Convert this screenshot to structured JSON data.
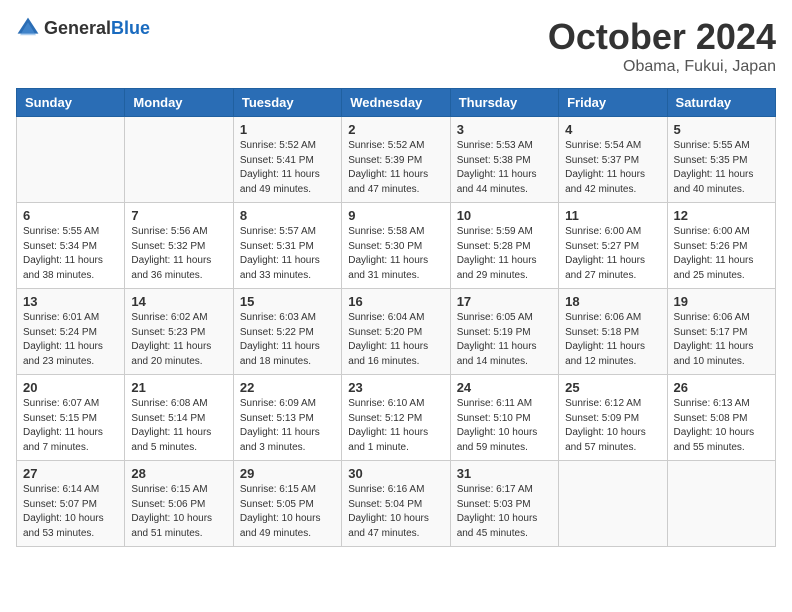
{
  "header": {
    "logo": {
      "general": "General",
      "blue": "Blue"
    },
    "title": "October 2024",
    "subtitle": "Obama, Fukui, Japan"
  },
  "weekdays": [
    "Sunday",
    "Monday",
    "Tuesday",
    "Wednesday",
    "Thursday",
    "Friday",
    "Saturday"
  ],
  "weeks": [
    [
      {
        "day": "",
        "content": ""
      },
      {
        "day": "",
        "content": ""
      },
      {
        "day": "1",
        "content": "Sunrise: 5:52 AM\nSunset: 5:41 PM\nDaylight: 11 hours and 49 minutes."
      },
      {
        "day": "2",
        "content": "Sunrise: 5:52 AM\nSunset: 5:39 PM\nDaylight: 11 hours and 47 minutes."
      },
      {
        "day": "3",
        "content": "Sunrise: 5:53 AM\nSunset: 5:38 PM\nDaylight: 11 hours and 44 minutes."
      },
      {
        "day": "4",
        "content": "Sunrise: 5:54 AM\nSunset: 5:37 PM\nDaylight: 11 hours and 42 minutes."
      },
      {
        "day": "5",
        "content": "Sunrise: 5:55 AM\nSunset: 5:35 PM\nDaylight: 11 hours and 40 minutes."
      }
    ],
    [
      {
        "day": "6",
        "content": "Sunrise: 5:55 AM\nSunset: 5:34 PM\nDaylight: 11 hours and 38 minutes."
      },
      {
        "day": "7",
        "content": "Sunrise: 5:56 AM\nSunset: 5:32 PM\nDaylight: 11 hours and 36 minutes."
      },
      {
        "day": "8",
        "content": "Sunrise: 5:57 AM\nSunset: 5:31 PM\nDaylight: 11 hours and 33 minutes."
      },
      {
        "day": "9",
        "content": "Sunrise: 5:58 AM\nSunset: 5:30 PM\nDaylight: 11 hours and 31 minutes."
      },
      {
        "day": "10",
        "content": "Sunrise: 5:59 AM\nSunset: 5:28 PM\nDaylight: 11 hours and 29 minutes."
      },
      {
        "day": "11",
        "content": "Sunrise: 6:00 AM\nSunset: 5:27 PM\nDaylight: 11 hours and 27 minutes."
      },
      {
        "day": "12",
        "content": "Sunrise: 6:00 AM\nSunset: 5:26 PM\nDaylight: 11 hours and 25 minutes."
      }
    ],
    [
      {
        "day": "13",
        "content": "Sunrise: 6:01 AM\nSunset: 5:24 PM\nDaylight: 11 hours and 23 minutes."
      },
      {
        "day": "14",
        "content": "Sunrise: 6:02 AM\nSunset: 5:23 PM\nDaylight: 11 hours and 20 minutes."
      },
      {
        "day": "15",
        "content": "Sunrise: 6:03 AM\nSunset: 5:22 PM\nDaylight: 11 hours and 18 minutes."
      },
      {
        "day": "16",
        "content": "Sunrise: 6:04 AM\nSunset: 5:20 PM\nDaylight: 11 hours and 16 minutes."
      },
      {
        "day": "17",
        "content": "Sunrise: 6:05 AM\nSunset: 5:19 PM\nDaylight: 11 hours and 14 minutes."
      },
      {
        "day": "18",
        "content": "Sunrise: 6:06 AM\nSunset: 5:18 PM\nDaylight: 11 hours and 12 minutes."
      },
      {
        "day": "19",
        "content": "Sunrise: 6:06 AM\nSunset: 5:17 PM\nDaylight: 11 hours and 10 minutes."
      }
    ],
    [
      {
        "day": "20",
        "content": "Sunrise: 6:07 AM\nSunset: 5:15 PM\nDaylight: 11 hours and 7 minutes."
      },
      {
        "day": "21",
        "content": "Sunrise: 6:08 AM\nSunset: 5:14 PM\nDaylight: 11 hours and 5 minutes."
      },
      {
        "day": "22",
        "content": "Sunrise: 6:09 AM\nSunset: 5:13 PM\nDaylight: 11 hours and 3 minutes."
      },
      {
        "day": "23",
        "content": "Sunrise: 6:10 AM\nSunset: 5:12 PM\nDaylight: 11 hours and 1 minute."
      },
      {
        "day": "24",
        "content": "Sunrise: 6:11 AM\nSunset: 5:10 PM\nDaylight: 10 hours and 59 minutes."
      },
      {
        "day": "25",
        "content": "Sunrise: 6:12 AM\nSunset: 5:09 PM\nDaylight: 10 hours and 57 minutes."
      },
      {
        "day": "26",
        "content": "Sunrise: 6:13 AM\nSunset: 5:08 PM\nDaylight: 10 hours and 55 minutes."
      }
    ],
    [
      {
        "day": "27",
        "content": "Sunrise: 6:14 AM\nSunset: 5:07 PM\nDaylight: 10 hours and 53 minutes."
      },
      {
        "day": "28",
        "content": "Sunrise: 6:15 AM\nSunset: 5:06 PM\nDaylight: 10 hours and 51 minutes."
      },
      {
        "day": "29",
        "content": "Sunrise: 6:15 AM\nSunset: 5:05 PM\nDaylight: 10 hours and 49 minutes."
      },
      {
        "day": "30",
        "content": "Sunrise: 6:16 AM\nSunset: 5:04 PM\nDaylight: 10 hours and 47 minutes."
      },
      {
        "day": "31",
        "content": "Sunrise: 6:17 AM\nSunset: 5:03 PM\nDaylight: 10 hours and 45 minutes."
      },
      {
        "day": "",
        "content": ""
      },
      {
        "day": "",
        "content": ""
      }
    ]
  ]
}
